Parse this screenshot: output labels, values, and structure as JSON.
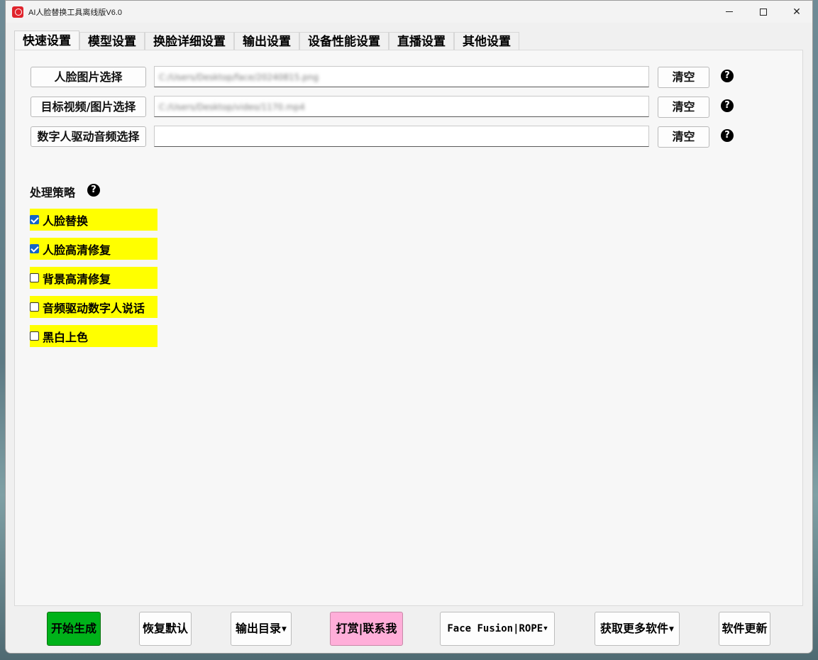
{
  "window": {
    "title": "AI人脸替换工具离线版V6.0"
  },
  "tabs": [
    "快速设置",
    "模型设置",
    "换脸详细设置",
    "输出设置",
    "设备性能设置",
    "直播设置",
    "其他设置"
  ],
  "inputs": [
    {
      "button_label": "人脸图片选择",
      "path": "C:/Users/Desktop/face/20240815.png",
      "clear_label": "清空"
    },
    {
      "button_label": "目标视频/图片选择",
      "path": "C:/Users/Desktop/video/1170.mp4",
      "clear_label": "清空"
    },
    {
      "button_label": "数字人驱动音频选择",
      "path": "",
      "clear_label": "清空"
    }
  ],
  "strategy": {
    "label": "处理策略",
    "options": [
      {
        "label": "人脸替换",
        "checked": true
      },
      {
        "label": "人脸高清修复",
        "checked": true
      },
      {
        "label": "背景高清修复",
        "checked": false
      },
      {
        "label": "音频驱动数字人说话",
        "checked": false
      },
      {
        "label": "黑白上色",
        "checked": false
      }
    ]
  },
  "toolbar": {
    "start": "开始生成",
    "reset": "恢复默认",
    "output_dir": "输出目录",
    "donate": "打赏|联系我",
    "engine": "Face Fusion|ROPE",
    "more_software": "获取更多软件",
    "update": "软件更新"
  },
  "colors": {
    "highlight": "#ffff00",
    "start_button": "#00b21a",
    "donate_button": "#ffaed9",
    "checkbox_checked": "#1466c6"
  },
  "icons": {
    "help": "question-circle-icon",
    "dropdown": "caret-down-icon",
    "app": "app-logo-icon"
  }
}
